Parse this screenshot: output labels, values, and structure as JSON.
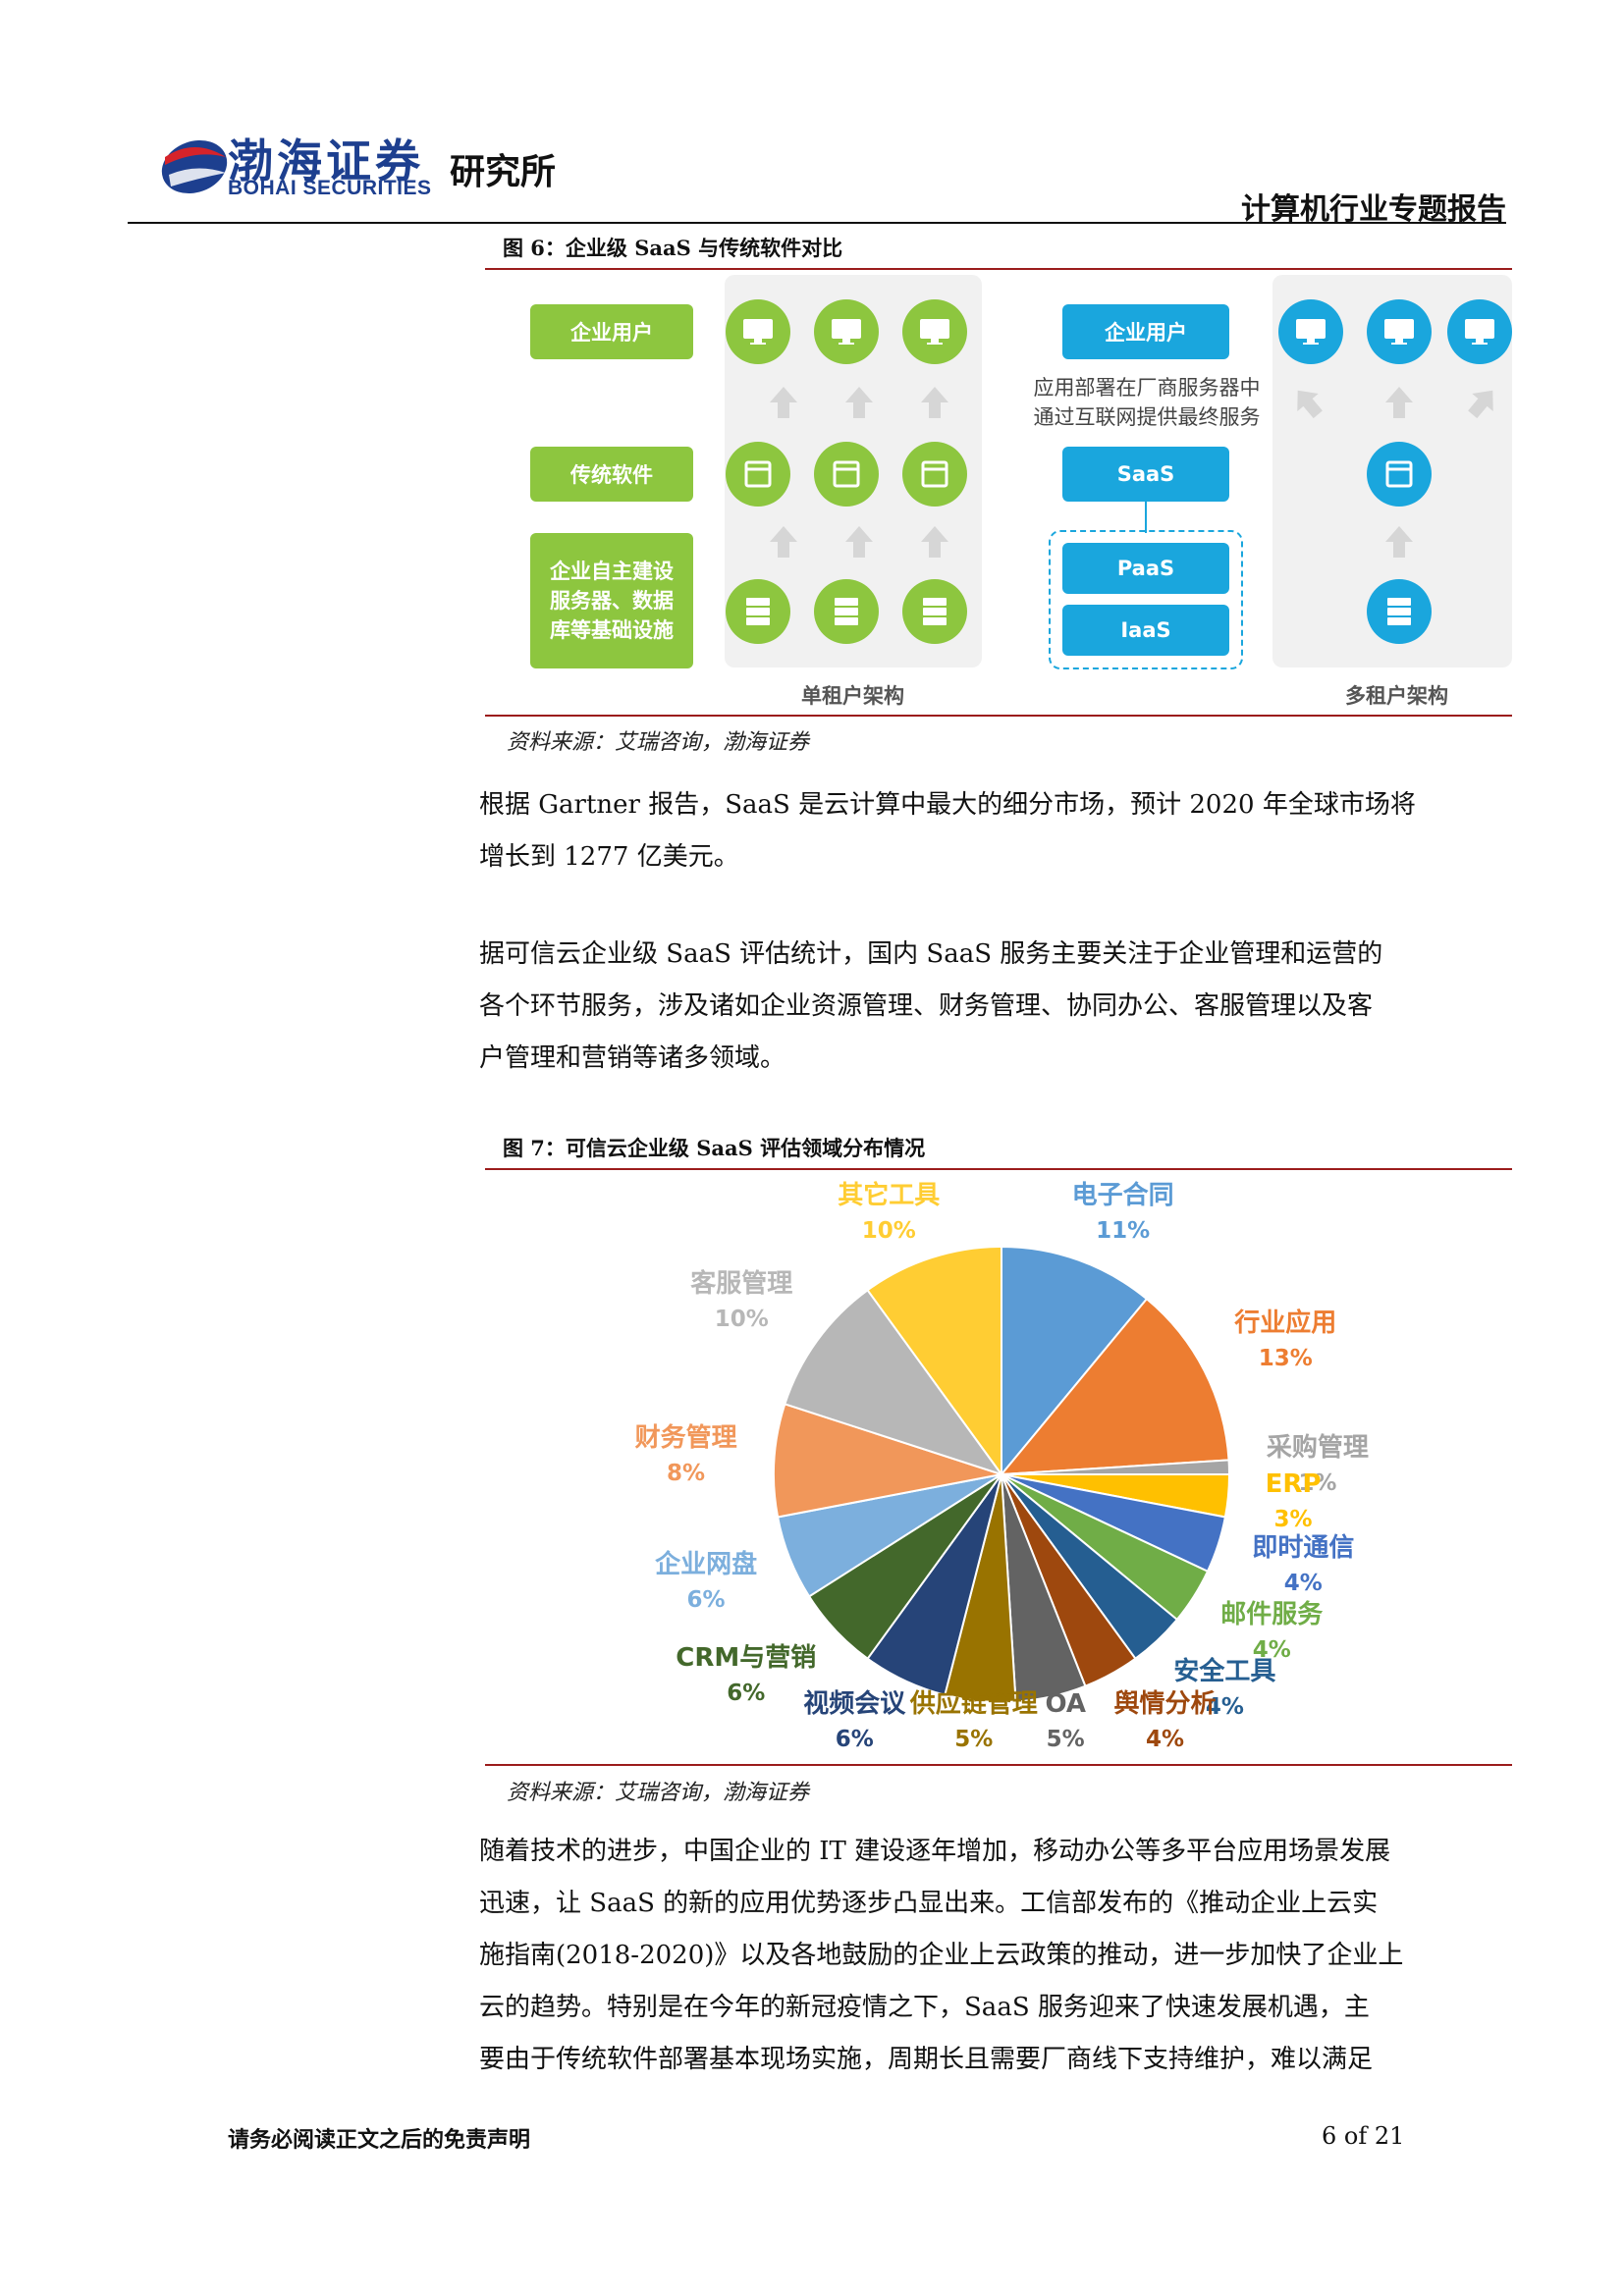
{
  "header": {
    "logo_cn": "渤海证券",
    "logo_en": "BOHAI SECURITIES",
    "institute": "研究所",
    "report_type": "计算机行业专题报告"
  },
  "figure6": {
    "caption": "图 6：企业级 SaaS 与传统软件对比",
    "left_labels": [
      "企业用户",
      "传统软件",
      "企业自主建设服务器、数据库等基础设施"
    ],
    "left_label3_lines": [
      "企业自主建设",
      "服务器、数据",
      "库等基础设施"
    ],
    "single_tenant_label": "单租户架构",
    "right_user": "企业用户",
    "note_lines": [
      "应用部署在厂商服务器中",
      "通过互联网提供最终服务"
    ],
    "saas": "SaaS",
    "paas": "PaaS",
    "iaas": "IaaS",
    "multi_tenant_label": "多租户架构",
    "colors": {
      "green": "#8dc63f",
      "blue": "#1aa6dd"
    },
    "icons": [
      "monitor-icon",
      "window-icon",
      "server-icon",
      "arrow-up-icon"
    ],
    "source": "资料来源：艾瑞咨询，渤海证券"
  },
  "para1": {
    "lines": [
      "根据 Gartner 报告，SaaS 是云计算中最大的细分市场，预计 2020 年全球市场将",
      "增长到 1277 亿美元。"
    ]
  },
  "para2": {
    "lines": [
      "据可信云企业级 SaaS 评估统计，国内 SaaS 服务主要关注于企业管理和运营的",
      "各个环节服务，涉及诸如企业资源管理、财务管理、协同办公、客服管理以及客",
      "户管理和营销等诸多领域。"
    ]
  },
  "figure7": {
    "caption": "图 7：可信云企业级 SaaS 评估领域分布情况",
    "source": "资料来源：艾瑞咨询，渤海证券"
  },
  "chart_data": {
    "type": "pie",
    "title": "",
    "unit": "%",
    "slices": [
      {
        "label": "电子合同",
        "value": 11,
        "pct_label": "11%",
        "color": "#5b9bd5"
      },
      {
        "label": "行业应用",
        "value": 13,
        "pct_label": "13%",
        "color": "#ed7d31"
      },
      {
        "label": "采购管理",
        "value": 1,
        "pct_label": "1%",
        "color": "#a5a5a5"
      },
      {
        "label": "ERP",
        "value": 3,
        "pct_label": "3%",
        "color": "#ffc000"
      },
      {
        "label": "即时通信",
        "value": 4,
        "pct_label": "4%",
        "color": "#4472c4"
      },
      {
        "label": "邮件服务",
        "value": 4,
        "pct_label": "4%",
        "color": "#70ad47"
      },
      {
        "label": "安全工具",
        "value": 4,
        "pct_label": "4%",
        "color": "#255e91"
      },
      {
        "label": "舆情分析",
        "value": 4,
        "pct_label": "4%",
        "color": "#9e480e"
      },
      {
        "label": "OA",
        "value": 5,
        "pct_label": "5%",
        "color": "#636363"
      },
      {
        "label": "供应链管理",
        "value": 5,
        "pct_label": "5%",
        "color": "#997300"
      },
      {
        "label": "视频会议",
        "value": 6,
        "pct_label": "6%",
        "color": "#264478"
      },
      {
        "label": "CRM与营销",
        "value": 6,
        "pct_label": "6%",
        "color": "#43682b"
      },
      {
        "label": "企业网盘",
        "value": 6,
        "pct_label": "6%",
        "color": "#7cafdd"
      },
      {
        "label": "财务管理",
        "value": 8,
        "pct_label": "8%",
        "color": "#f1975a"
      },
      {
        "label": "客服管理",
        "value": 10,
        "pct_label": "10%",
        "color": "#b7b7b7"
      },
      {
        "label": "其它工具",
        "value": 10,
        "pct_label": "10%",
        "color": "#ffcd33"
      }
    ]
  },
  "para3": {
    "lines": [
      "随着技术的进步，中国企业的 IT 建设逐年增加，移动办公等多平台应用场景发展",
      "迅速，让 SaaS 的新的应用优势逐步凸显出来。工信部发布的《推动企业上云实",
      "施指南(2018-2020)》以及各地鼓励的企业上云政策的推动，进一步加快了企业上",
      "云的趋势。特别是在今年的新冠疫情之下，SaaS 服务迎来了快速发展机遇，主",
      "要由于传统软件部署基本现场实施，周期长且需要厂商线下支持维护，难以满足"
    ]
  },
  "footer": {
    "disclaimer": "请务必阅读正文之后的免责声明",
    "page": "6 of 21"
  }
}
